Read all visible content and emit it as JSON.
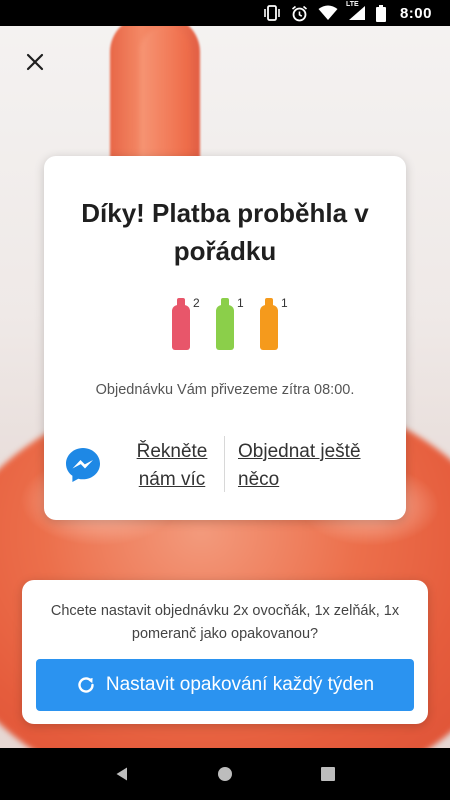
{
  "status_bar": {
    "time": "8:00",
    "icons": [
      "vibrate-icon",
      "alarm-icon",
      "wifi-icon",
      "signal-lte-icon",
      "battery-icon"
    ],
    "lte_label": "LTE"
  },
  "confirmation": {
    "title": "Díky! Platba proběhla v pořádku",
    "bottles": [
      {
        "name": "ovocňák",
        "count": "2",
        "color": "#e8566a"
      },
      {
        "name": "zelňák",
        "count": "1",
        "color": "#8bcf4a"
      },
      {
        "name": "pomeranč",
        "count": "1",
        "color": "#f59a1c"
      }
    ],
    "delivery_text": "Objednávku Vám přivezeme zítra 08:00.",
    "tell_us_more_label": "Řekněte nám víc",
    "order_more_label": "Objednat ještě něco"
  },
  "repeat": {
    "question": "Chcete nastavit objednávku 2x ovocňák, 1x zelňák, 1x pomeranč jako opakovanou?",
    "button_label": "Nastavit opakování každý týden"
  },
  "colors": {
    "accent": "#2b93f0",
    "messenger": "#1e88e5"
  }
}
